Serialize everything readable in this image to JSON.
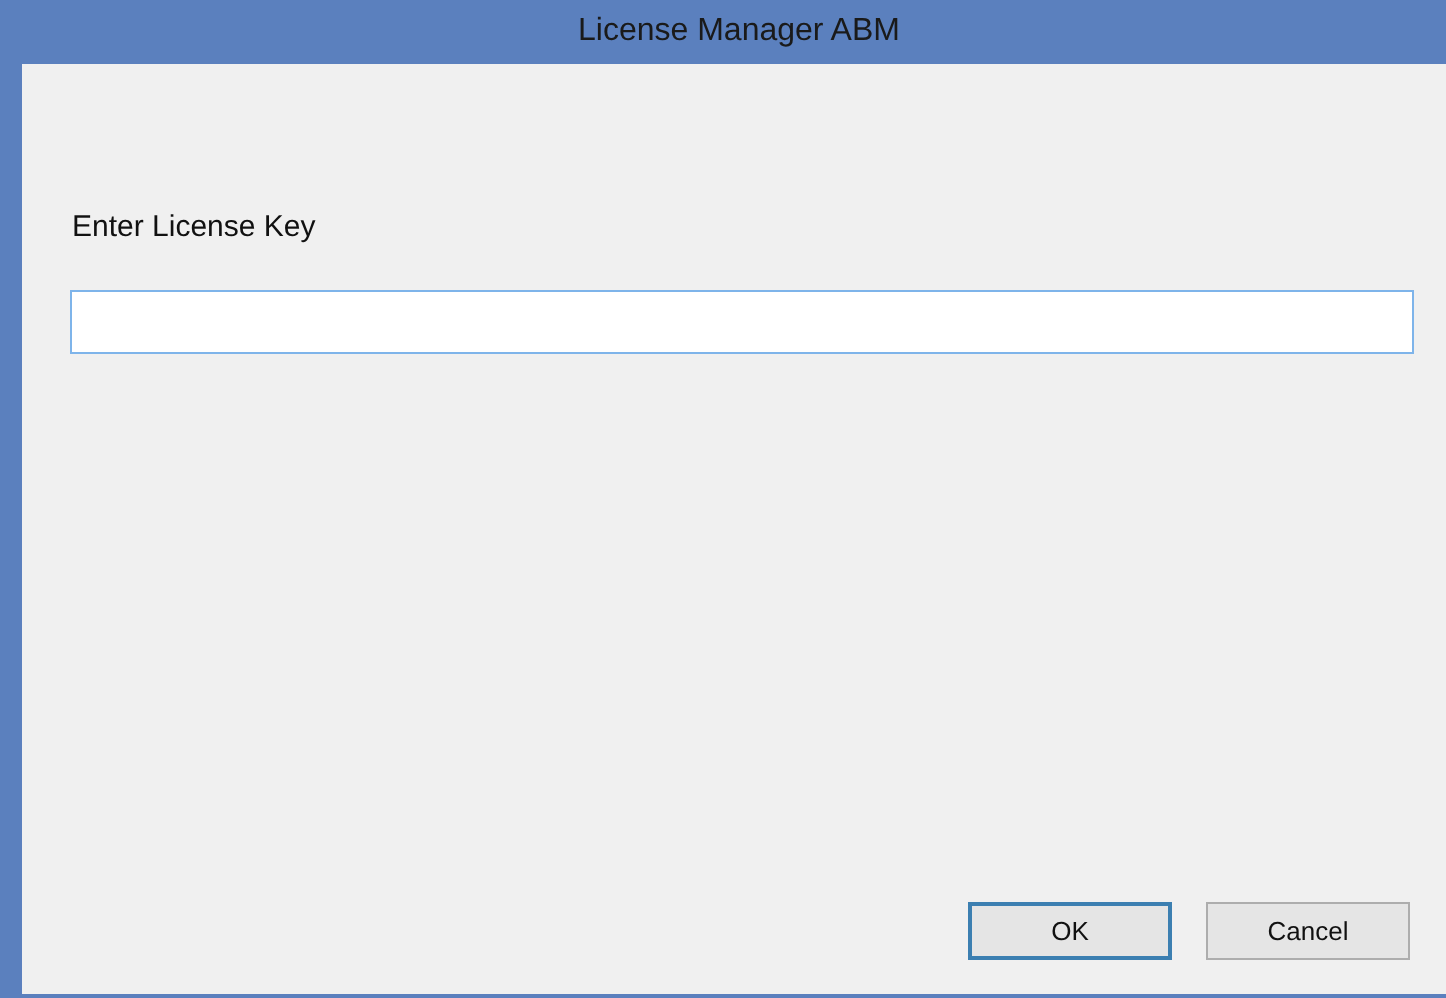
{
  "window": {
    "title": "License Manager ABM"
  },
  "prompt": "Enter License Key",
  "license_key_field": {
    "focused": true
  },
  "buttons": [
    {
      "label": "OK",
      "default": true
    },
    {
      "label": "Cancel",
      "default": false
    }
  ]
}
